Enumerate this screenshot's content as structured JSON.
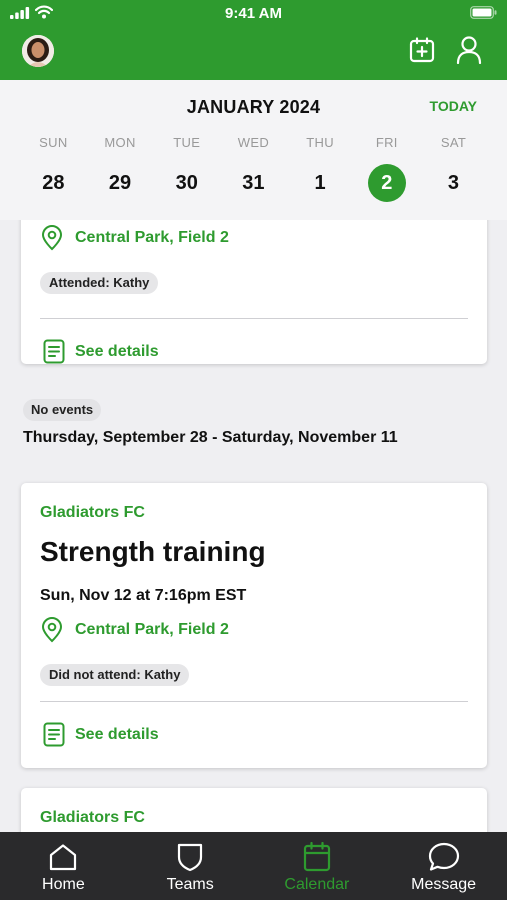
{
  "status_bar": {
    "time": "9:41 AM"
  },
  "header": {
    "avatar": "user-avatar",
    "actions": [
      "add-event-icon",
      "profile-icon"
    ]
  },
  "calendar": {
    "month": "JANUARY 2024",
    "today_label": "TODAY",
    "days": [
      {
        "dow": "SUN",
        "num": "28"
      },
      {
        "dow": "MON",
        "num": "29"
      },
      {
        "dow": "TUE",
        "num": "30"
      },
      {
        "dow": "WED",
        "num": "31"
      },
      {
        "dow": "THU",
        "num": "1"
      },
      {
        "dow": "FRI",
        "num": "2",
        "selected": true
      },
      {
        "dow": "SAT",
        "num": "3"
      }
    ]
  },
  "events": [
    {
      "location": "Central Park, Field 2",
      "attendance": "Attended: Kathy",
      "details_label": "See details"
    },
    {
      "team": "Gladiators FC",
      "title": "Strength training",
      "when": "Sun, Nov 12 at 7:16pm EST",
      "location": "Central Park, Field 2",
      "attendance": "Did not attend: Kathy",
      "details_label": "See details"
    },
    {
      "team": "Gladiators FC"
    }
  ],
  "gap": {
    "badge": "No events",
    "range": "Thursday, September 28 - Saturday, November 11"
  },
  "tabs": [
    {
      "label": "Home",
      "icon": "home-icon"
    },
    {
      "label": "Teams",
      "icon": "shield-icon"
    },
    {
      "label": "Calendar",
      "icon": "calendar-icon",
      "active": true
    },
    {
      "label": "Message",
      "icon": "chat-bubble-icon"
    }
  ],
  "colors": {
    "brand": "#2e9b2f",
    "tabbar": "#2a2a2c",
    "background": "#efeff2"
  }
}
